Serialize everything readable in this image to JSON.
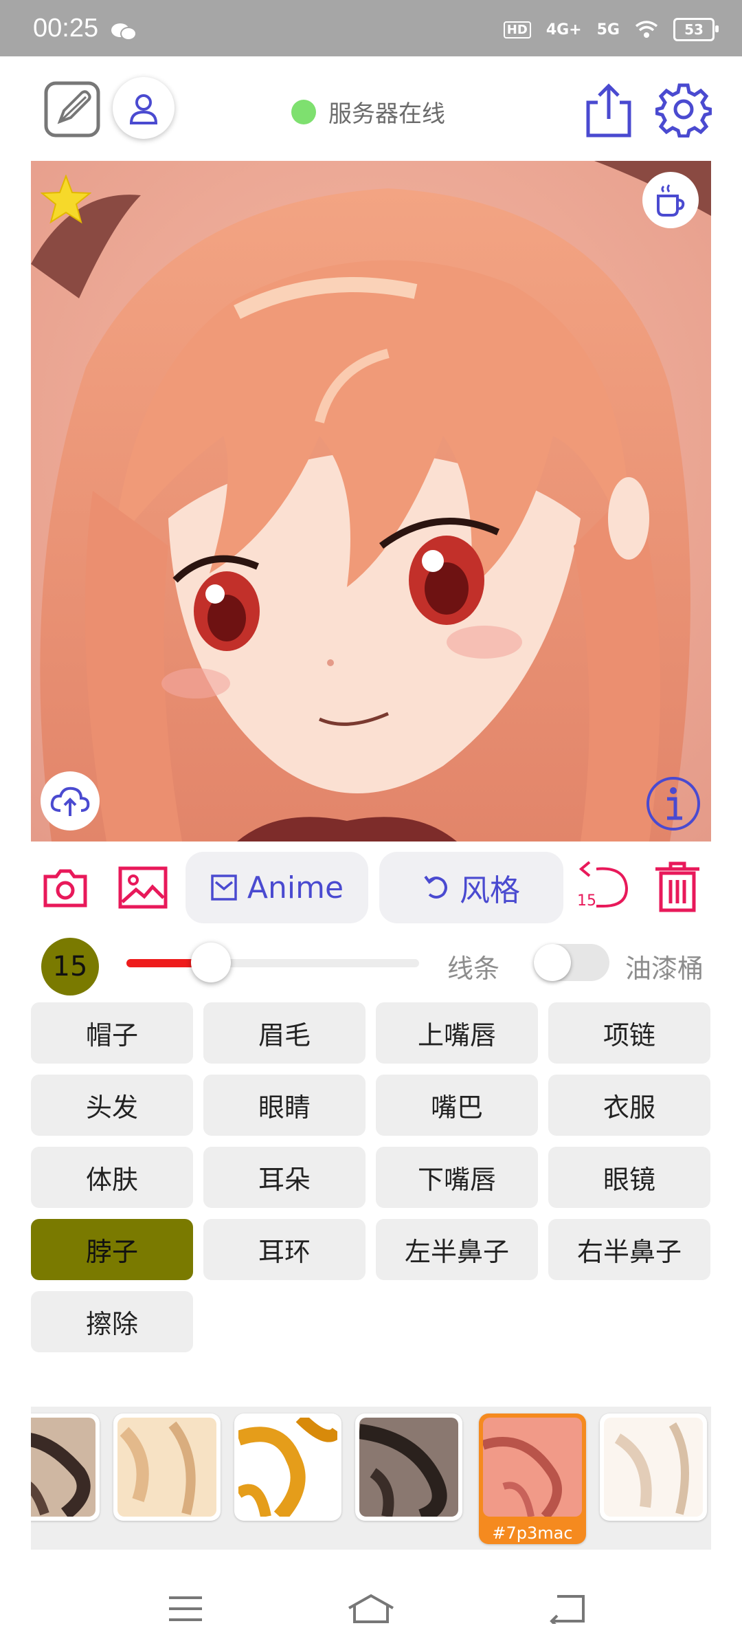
{
  "status_bar": {
    "time": "00:25",
    "hd": "HD",
    "net1": "4G+",
    "net2": "5G",
    "battery": "53"
  },
  "header": {
    "server_status": "服务器在线",
    "server_status_color": "#7ee06f"
  },
  "toolbar": {
    "anime_label": "Anime",
    "style_label": "风格",
    "undo_count": "15"
  },
  "brush": {
    "size": "15",
    "slider_fraction": 0.3,
    "line_label": "线条",
    "bucket_label": "油漆桶",
    "bucket_on": false
  },
  "parts": [
    "帽子",
    "眉毛",
    "上嘴唇",
    "项链",
    "头发",
    "眼睛",
    "嘴巴",
    "衣服",
    "体肤",
    "耳朵",
    "下嘴唇",
    "眼镜",
    "脖子",
    "耳环",
    "左半鼻子",
    "右半鼻子",
    "擦除"
  ],
  "selected_part": "脖子",
  "selected_color": "#7a7a00",
  "swatches": {
    "selected_tag": "#7p3mac",
    "selected_border": "#f58a1f"
  },
  "accent": "#4a4ad0",
  "danger": "#e8195a"
}
